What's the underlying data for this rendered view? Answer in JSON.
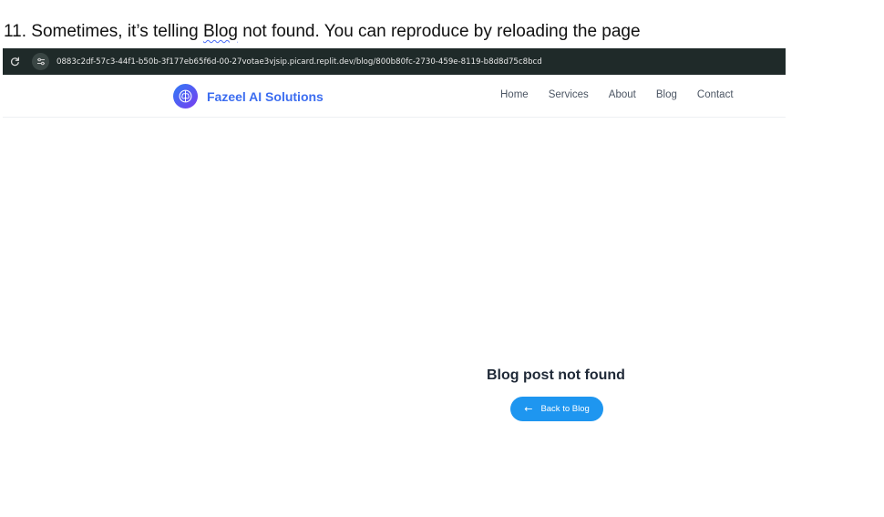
{
  "caption": {
    "prefix": "11. Sometimes, it’s telling ",
    "underlined": "Blog",
    "suffix": " not found. You can reproduce by reloading the page"
  },
  "browser": {
    "reload_glyph": "C",
    "url": "0883c2df-57c3-44f1-b50b-3f177eb65f6d-00-27votae3vjsip.picard.replit.dev/blog/800b80fc-2730-459e-8119-b8d8d75c8bcd"
  },
  "navbar": {
    "brand_name": "Fazeel AI Solutions",
    "brand_icon": "brain-icon",
    "links": [
      "Home",
      "Services",
      "About",
      "Blog",
      "Contact"
    ]
  },
  "main": {
    "message": "Blog post not found",
    "back_label": "Back to Blog",
    "back_icon": "arrow-left-icon"
  },
  "colors": {
    "brand_text": "#3c6df0",
    "button": "#1e96f0",
    "urlbar": "#1f2a29"
  }
}
